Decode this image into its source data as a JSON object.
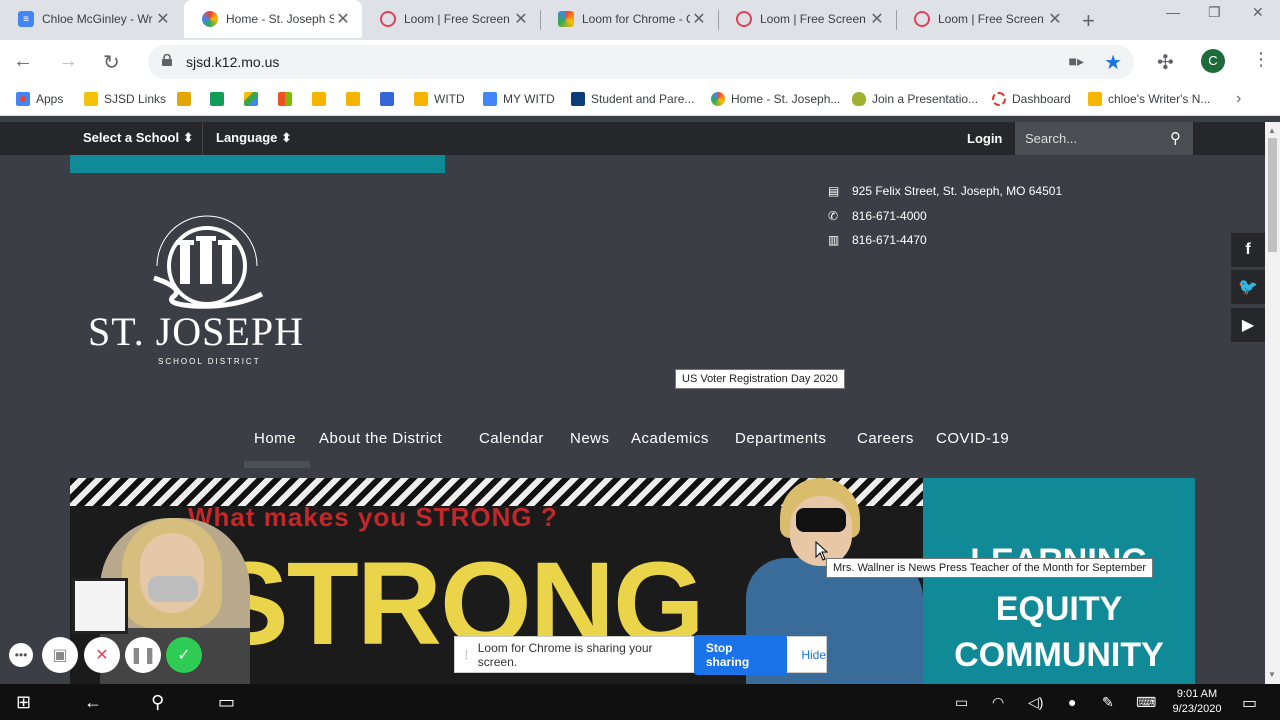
{
  "browser": {
    "tabs": [
      {
        "title": "Chloe McGinley - Wr",
        "favicon": "docs-icon",
        "color": "#4285f4"
      },
      {
        "title": "Home - St. Joseph Sc",
        "favicon": "sjsd-icon",
        "color": "#3b7dd8",
        "active": true
      },
      {
        "title": "Loom | Free Screen &",
        "favicon": "loom-icon",
        "color": "#e0425b"
      },
      {
        "title": "Loom for Chrome - C",
        "favicon": "webstore-icon",
        "color": "#e37400"
      },
      {
        "title": "Loom | Free Screen &",
        "favicon": "loom-icon",
        "color": "#e0425b"
      },
      {
        "title": "Loom | Free Screen &",
        "favicon": "loom-icon",
        "color": "#e0425b"
      }
    ],
    "url": "sjsd.k12.mo.us",
    "profile_initial": "C",
    "bookmarks": [
      {
        "label": "Apps",
        "color": "#ea4335"
      },
      {
        "label": "SJSD Links",
        "color": "#f4c20d"
      },
      {
        "label": "",
        "color": "#e0a800"
      },
      {
        "label": "",
        "color": "#0f9d58"
      },
      {
        "label": "",
        "color": "#4285f4"
      },
      {
        "label": "",
        "color": "#f25022"
      },
      {
        "label": "",
        "color": "#f4b400"
      },
      {
        "label": "",
        "color": "#f4b400"
      },
      {
        "label": "",
        "color": "#3367d6"
      },
      {
        "label": "WITD",
        "color": "#f4b400"
      },
      {
        "label": "MY WITD",
        "color": "#4285f4"
      },
      {
        "label": "Student and Pare...",
        "color": "#0d3c7a"
      },
      {
        "label": "Home - St. Joseph...",
        "color": "#3b7dd8"
      },
      {
        "label": "Join a Presentatio...",
        "color": "#a0b030"
      },
      {
        "label": "Dashboard",
        "color": "#e03a2f"
      },
      {
        "label": "chloe's Writer's N...",
        "color": "#f4b400"
      }
    ]
  },
  "site": {
    "topbar": {
      "select_school": "Select a School",
      "language": "Language",
      "login": "Login",
      "search_placeholder": "Search..."
    },
    "logo": {
      "name": "ST. JOSEPH",
      "sub": "SCHOOL DISTRICT",
      "arc_text": "LEARNING • EQUITY • COMMUNITY"
    },
    "contact": {
      "address": "925 Felix Street, St. Joseph, MO 64501",
      "phone": "816-671-4000",
      "fax": "816-671-4470"
    },
    "tooltip_event": "US Voter Registration Day 2020",
    "nav": [
      "Home",
      "About the District",
      "Calendar",
      "News",
      "Academics",
      "Departments",
      "Careers",
      "COVID-19"
    ],
    "hero": {
      "headline": "What makes you STRONG ?",
      "strong": "STRONG",
      "caption": "Mrs. Wallner is News Press Teacher of the Month for September"
    },
    "values_panel": [
      "LEARNING",
      "EQUITY",
      "COMMUNITY"
    ]
  },
  "loom": {
    "message": "Loom for Chrome is sharing your screen.",
    "stop": "Stop sharing",
    "hide": "Hide"
  },
  "taskbar": {
    "time": "9:01 AM",
    "date": "9/23/2020"
  },
  "colors": {
    "teal": "#0f8a96",
    "site_bg": "#3b3f45",
    "chrome_blue": "#1a73e8"
  }
}
